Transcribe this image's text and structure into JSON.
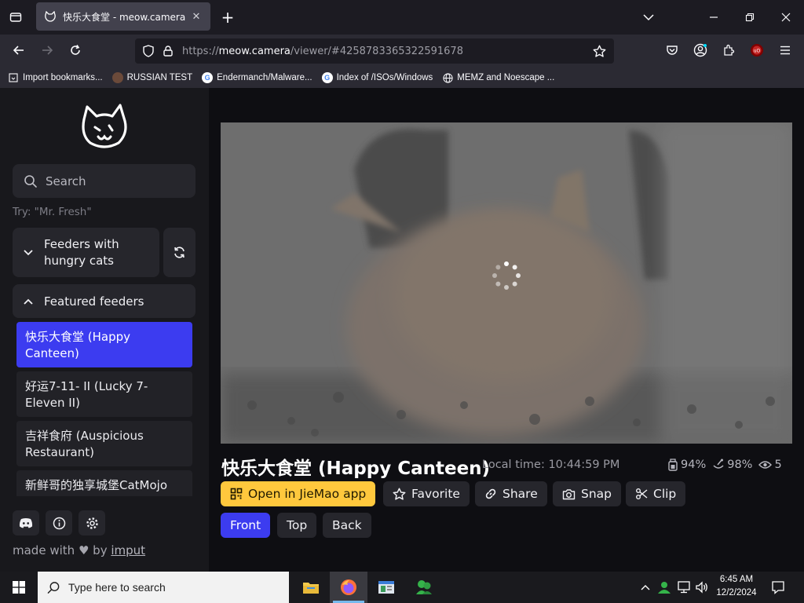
{
  "browser": {
    "tab_title": "快乐大食堂 - meow.camera",
    "tab_close": "✕",
    "new_tab": "+",
    "url_scheme": "https://",
    "url_host": "meow.camera",
    "url_path": "/viewer/#4258783365322591678"
  },
  "bookmarks": [
    {
      "label": "Import bookmarks...",
      "icon": "import-icon"
    },
    {
      "label": "RUSSIAN TEST",
      "icon": "site-icon"
    },
    {
      "label": "Endermanch/Malware...",
      "icon": "google-icon"
    },
    {
      "label": "Index of /ISOs/Windows",
      "icon": "google-icon"
    },
    {
      "label": "MEMZ and Noescape ...",
      "icon": "globe-icon"
    }
  ],
  "sidebar": {
    "search_placeholder": "Search",
    "try_hint": "Try: \"Mr. Fresh\"",
    "hungry_label_1": "Feeders with",
    "hungry_label_2": "hungry cats",
    "featured_label": "Featured feeders",
    "feeders": [
      {
        "line1": "快乐大食堂 (Happy",
        "line2": "Canteen)",
        "active": true
      },
      {
        "line1": "好运7-11- II  (Lucky 7-",
        "line2": "Eleven II)",
        "active": false
      },
      {
        "line1": "吉祥食府 (Auspicious",
        "line2": "Restaurant)",
        "active": false
      },
      {
        "line1": "新鲜哥的独享城堡CatMojo",
        "line2": "",
        "active": false
      }
    ],
    "made_with": "made with",
    "by": "by",
    "author": "imput"
  },
  "feed": {
    "title": "快乐大食堂 (Happy Canteen)",
    "local_time": "Local time: 10:44:59 PM",
    "food_level": "94%",
    "battery_level": "98%",
    "viewers": "5"
  },
  "actions": {
    "open_app": "Open in JieMao app",
    "favorite": "Favorite",
    "share": "Share",
    "snap": "Snap",
    "clip": "Clip"
  },
  "views": {
    "front": "Front",
    "top": "Top",
    "back": "Back"
  },
  "taskbar": {
    "search_placeholder": "Type here to search",
    "time": "6:45 AM",
    "date": "12/2/2024"
  },
  "colors": {
    "accent": "#3c3cf0",
    "open_app": "#ffc83d"
  }
}
